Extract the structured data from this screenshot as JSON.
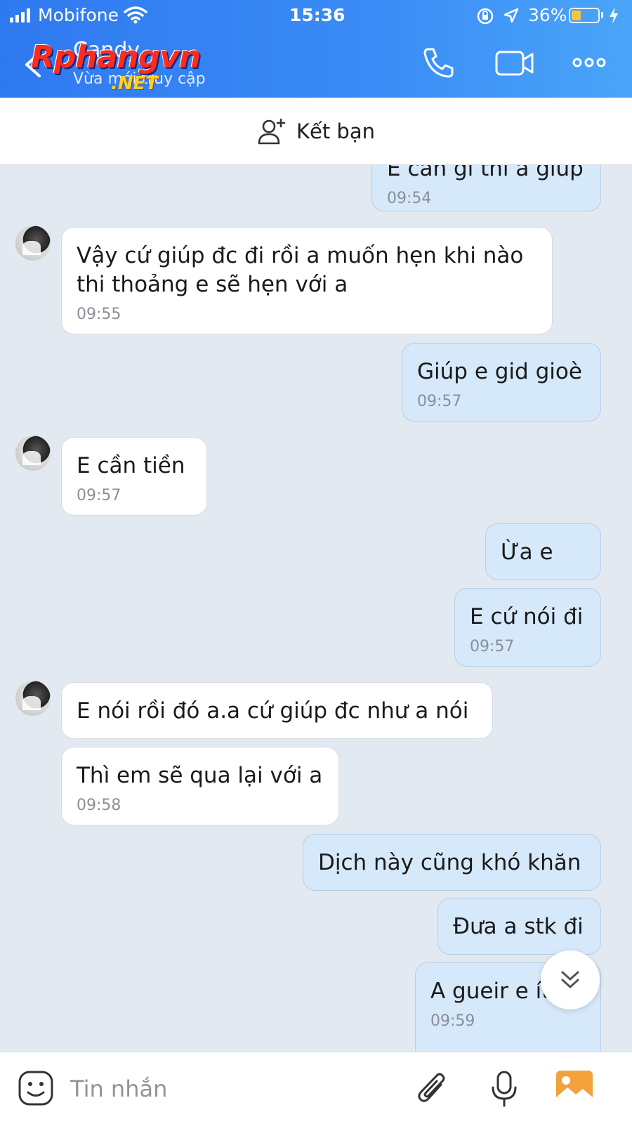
{
  "status_bar": {
    "carrier": "Mobifone",
    "time": "15:36",
    "battery": "36%",
    "battery_level": 0.36
  },
  "header": {
    "contact_name": "Candy",
    "contact_status": "Vừa mới truy cập",
    "watermark": "Rphangvn",
    "watermark_suffix": ".NET",
    "icons": [
      "back-icon",
      "phone-icon",
      "video-call-icon",
      "more-icon"
    ]
  },
  "friend_bar": {
    "label": "Kết bạn",
    "icon": "add-friend-icon"
  },
  "messages": [
    {
      "side": "out",
      "text": "E cần gì thì a giúp",
      "time": "09:54"
    },
    {
      "side": "in",
      "text": "Vậy cứ giúp đc đi rồi a muốn hẹn khi nào thi thoảng e sẽ hẹn với a",
      "time": "09:55"
    },
    {
      "side": "out",
      "text": "Giúp e gid gioè",
      "time": "09:57"
    },
    {
      "side": "in",
      "text": "E cần tiền",
      "time": "09:57"
    },
    {
      "side": "out",
      "text": "Ừa e",
      "time": ""
    },
    {
      "side": "out",
      "text": "E cứ nói đi",
      "time": "09:57"
    },
    {
      "side": "in",
      "text": "E nói rồi đó a.a cứ giúp đc như a nói",
      "time": ""
    },
    {
      "side": "in",
      "text": "Thì em sẽ qua lại với a",
      "time": "09:58"
    },
    {
      "side": "out",
      "text": "Dịch này cũng khó khăn",
      "time": ""
    },
    {
      "side": "out",
      "text": "Đưa a stk đi",
      "time": ""
    },
    {
      "side": "out",
      "text": "A gueir e ít nè",
      "time": "09:59"
    }
  ],
  "input_bar": {
    "placeholder": "Tin nhắn",
    "icons": [
      "emoji-icon",
      "attach-icon",
      "microphone-icon",
      "image-icon"
    ]
  },
  "colors": {
    "header_start": "#2f79f0",
    "header_end": "#4aa5f8",
    "chat_bg": "#e2e9f1",
    "outgoing_bubble": "#d6e9fb",
    "incoming_bubble": "#ffffff"
  }
}
